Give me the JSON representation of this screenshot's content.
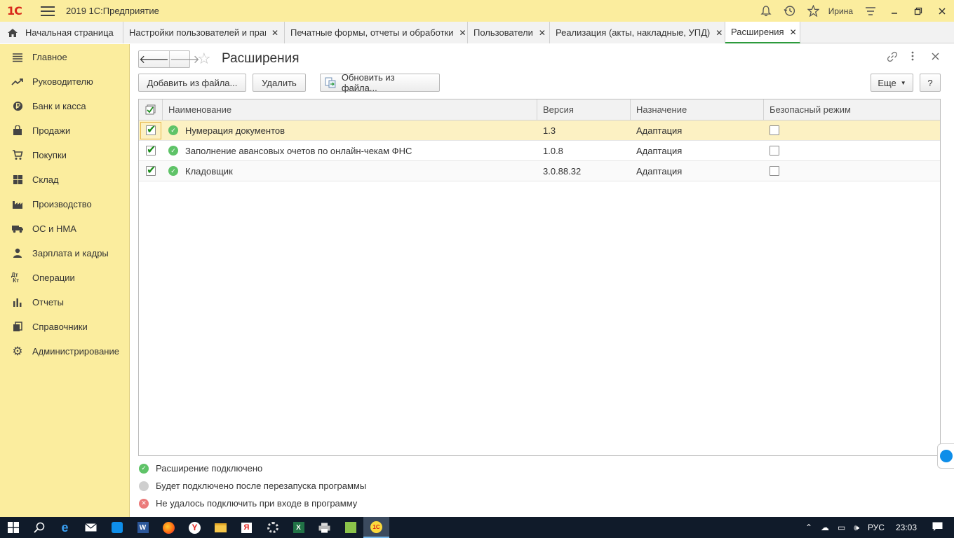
{
  "titlebar": {
    "logo": "1С",
    "title": "2019 1С:Предприятие",
    "user": "Ирина",
    "icons": [
      "bell-icon",
      "history-icon",
      "star-icon",
      "settings-lines-icon",
      "minimize-icon",
      "restore-icon",
      "close-icon"
    ]
  },
  "tabs": [
    {
      "label": "Начальная страница"
    },
    {
      "label": "Настройки пользователей и прав"
    },
    {
      "label": "Печатные формы, отчеты и обработки"
    },
    {
      "label": "Пользователи"
    },
    {
      "label": "Реализация (акты, накладные, УПД)"
    },
    {
      "label": "Расширения"
    }
  ],
  "sidebar": {
    "items": [
      {
        "label": "Главное",
        "icon": "list-icon"
      },
      {
        "label": "Руководителю",
        "icon": "trend-icon"
      },
      {
        "label": "Банк и касса",
        "icon": "ruble-icon"
      },
      {
        "label": "Продажи",
        "icon": "bag-icon"
      },
      {
        "label": "Покупки",
        "icon": "cart-icon"
      },
      {
        "label": "Склад",
        "icon": "warehouse-icon"
      },
      {
        "label": "Производство",
        "icon": "factory-icon"
      },
      {
        "label": "ОС и НМА",
        "icon": "truck-icon"
      },
      {
        "label": "Зарплата и кадры",
        "icon": "person-icon"
      },
      {
        "label": "Операции",
        "icon": "dt-kt-icon"
      },
      {
        "label": "Отчеты",
        "icon": "bar-chart-icon"
      },
      {
        "label": "Справочники",
        "icon": "books-icon"
      },
      {
        "label": "Администрирование",
        "icon": "gear-icon"
      }
    ]
  },
  "page": {
    "title": "Расширения",
    "buttons": {
      "add": "Добавить из файла...",
      "delete": "Удалить",
      "update": "Обновить из файла...",
      "more": "Еще",
      "help": "?"
    }
  },
  "table": {
    "columns": [
      "Наименование",
      "Версия",
      "Назначение",
      "Безопасный режим"
    ],
    "rows": [
      {
        "active": true,
        "status": "connected",
        "name": "Нумерация документов",
        "version": "1.3",
        "purpose": "Адаптация",
        "safe_mode": false
      },
      {
        "active": true,
        "status": "connected",
        "name": "Заполнение авансовых очетов по онлайн-чекам ФНС",
        "version": "1.0.8",
        "purpose": "Адаптация",
        "safe_mode": false
      },
      {
        "active": true,
        "status": "connected",
        "name": "Кладовщик",
        "version": "3.0.88.32",
        "purpose": "Адаптация",
        "safe_mode": false
      }
    ]
  },
  "legend": [
    {
      "status": "connected",
      "text": "Расширение подключено"
    },
    {
      "status": "pending",
      "text": "Будет подключено после перезапуска программы"
    },
    {
      "status": "failed",
      "text": "Не удалось подключить при входе в программу"
    }
  ],
  "taskbar": {
    "icons": [
      "windows-start-icon",
      "search-icon",
      "edge-icon",
      "mail-icon",
      "teamviewer-icon",
      "word-icon",
      "firefox-icon",
      "yandex-browser-icon",
      "file-explorer-icon",
      "yandex-icon",
      "media-icon",
      "excel-icon",
      "printer-icon",
      "app-icon",
      "1c-icon"
    ],
    "language": "РУС",
    "time": "23:03"
  }
}
